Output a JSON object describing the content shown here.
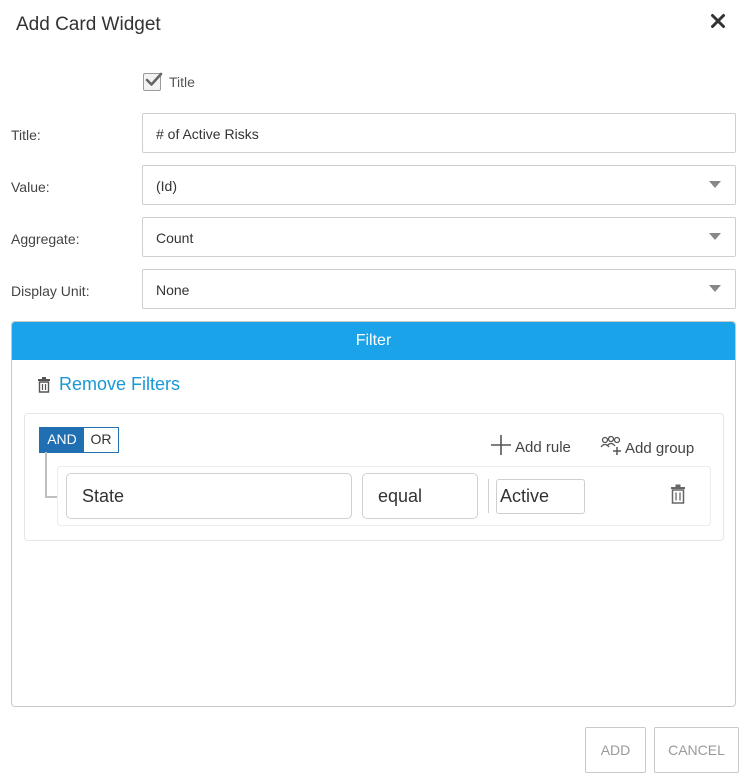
{
  "dialog": {
    "title": "Add Card Widget",
    "close_icon": "close-icon"
  },
  "title_checkbox": {
    "label": "Title",
    "checked": true
  },
  "form": {
    "title": {
      "label": "Title:",
      "value": "# of Active Risks"
    },
    "value": {
      "label": "Value:",
      "value": "(Id)"
    },
    "aggregate": {
      "label": "Aggregate:",
      "value": "Count"
    },
    "display_unit": {
      "label": "Display Unit:",
      "value": "None"
    }
  },
  "filter": {
    "header": "Filter",
    "header_color": "#1aa3e8",
    "remove_label": "Remove Filters",
    "remove_icon": "trash-icon",
    "logic": {
      "and_label": "AND",
      "or_label": "OR",
      "selected": "AND"
    },
    "add_rule_label": "Add rule",
    "add_group_label": "Add group",
    "rule": {
      "field": "State",
      "operator": "equal",
      "value": "Active"
    }
  },
  "footer": {
    "add_label": "ADD",
    "cancel_label": "CANCEL"
  }
}
